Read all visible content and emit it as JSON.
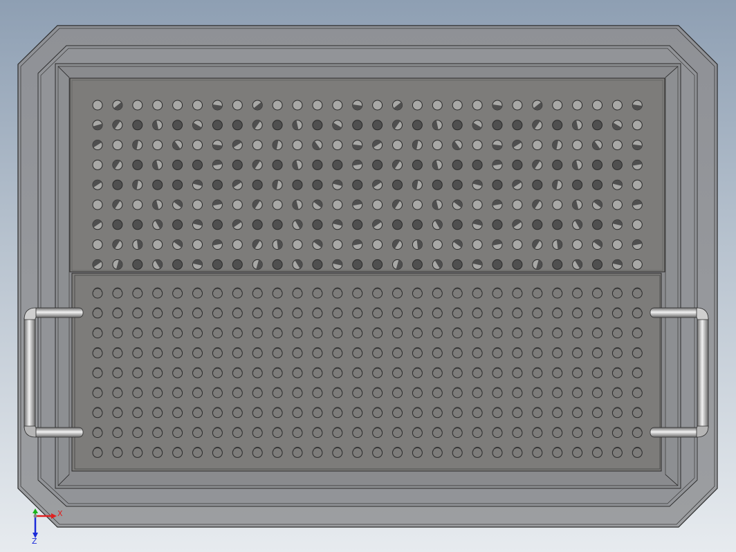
{
  "viewport": {
    "background_top": "#8e9fb3",
    "background_bottom": "#e7ebef"
  },
  "model": {
    "name": "perforated-tray-with-handles",
    "colors": {
      "tray_outer": "#8a8d91",
      "tray_wall": "#9a9b9d",
      "plate": "#7d7c7a",
      "hole_light": "#a8a8a6",
      "hole_dark": "#4f4f4f",
      "outline": "#2a2a2a",
      "handle_light": "#e6e6e6",
      "handle_dark": "#6e6e6e"
    },
    "upper_plate": {
      "rows": 9,
      "columns": 28
    },
    "lower_plate": {
      "rows": 9,
      "columns": 28
    },
    "handles": [
      "left",
      "right"
    ]
  },
  "triad": {
    "x_label": "X",
    "z_label": "Z",
    "x_color": "#e02020",
    "y_color": "#19b319",
    "z_color": "#1a2ad9"
  }
}
